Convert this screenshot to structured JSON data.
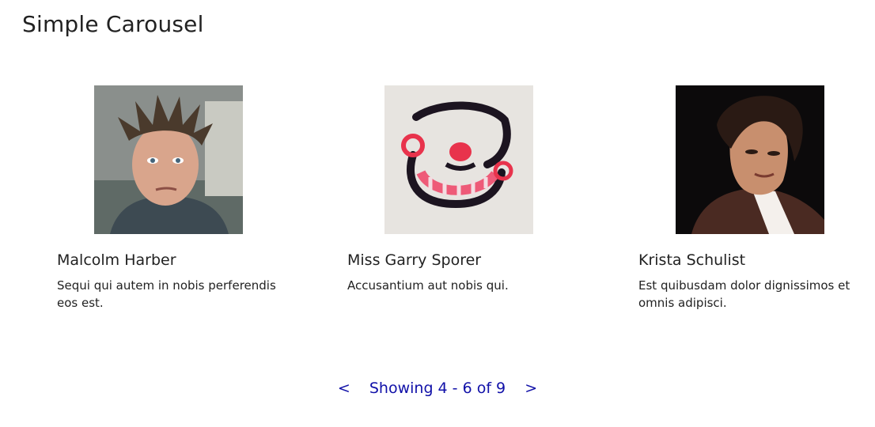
{
  "page": {
    "title": "Simple Carousel"
  },
  "cards": [
    {
      "name": "Malcolm Harber",
      "description": "Sequi qui autem in nobis perferendis eos est."
    },
    {
      "name": "Miss Garry Sporer",
      "description": "Accusantium aut nobis qui."
    },
    {
      "name": "Krista Schulist",
      "description": "Est quibusdam dolor dignissimos et omnis adipisci."
    }
  ],
  "pager": {
    "prev": "<",
    "status": "Showing 4 - 6 of 9",
    "next": ">"
  },
  "colors": {
    "link": "#1010a8",
    "text": "#222222"
  }
}
